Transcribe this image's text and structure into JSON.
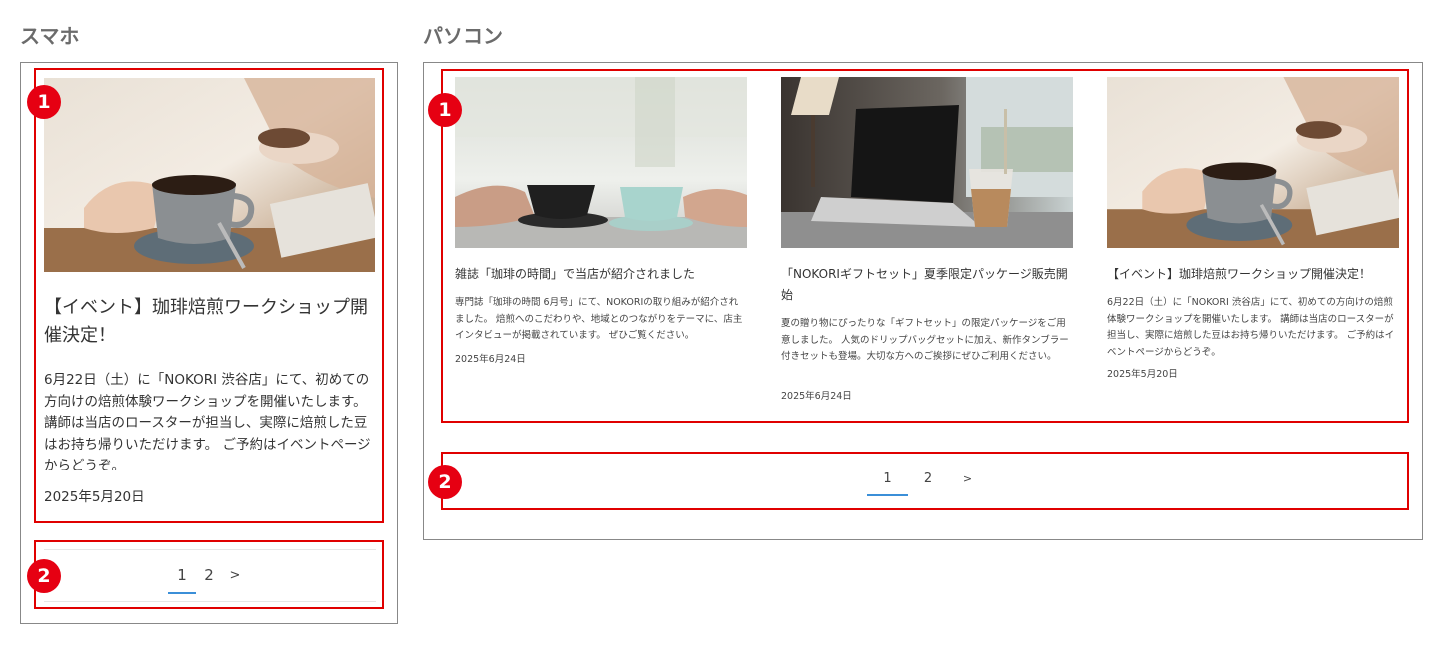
{
  "sections": {
    "mobile_title": "スマホ",
    "pc_title": "パソコン"
  },
  "badges": {
    "one": "1",
    "two": "2"
  },
  "mobile_card": {
    "title": "【イベント】珈琲焙煎ワークショップ開催決定！",
    "description": "6月22日（土）に「NOKORI 渋谷店」にて、初めての方向けの焙煎体験ワークショップを開催いたします。 講師は当店のロースターが担当し、実際に焙煎した豆はお持ち帰りいただけます。 ご予約はイベントページからどうぞ。",
    "date": "2025年5月20日",
    "image": "coffee-cup-hands-photo"
  },
  "pagination": {
    "pages": [
      "1",
      "2"
    ],
    "next": ">",
    "active": "1"
  },
  "pc_cards": [
    {
      "title": "雑誌「珈琲の時間」で当店が紹介されました",
      "description": "専門誌「珈琲の時間 6月号」にて、NOKORIの取り組みが紹介されました。 焙煎へのこだわりや、地域とのつながりをテーマに、店主インタビューが掲載されています。 ぜひご覧ください。",
      "date": "2025年6月24日",
      "image": "two-cups-toast-photo"
    },
    {
      "title": "「NOKORIギフトセット」夏季限定パッケージ販売開始",
      "description": "夏の贈り物にぴったりな「ギフトセット」の限定パッケージをご用意しました。 人気のドリップバッグセットに加え、新作タンブラー付きセットも登場。大切な方へのご挨拶にぜひご利用ください。",
      "date": "2025年6月24日",
      "image": "laptop-iced-coffee-photo"
    },
    {
      "title": "【イベント】珈琲焙煎ワークショップ開催決定！",
      "description": "6月22日（土）に「NOKORI 渋谷店」にて、初めての方向けの焙煎体験ワークショップを開催いたします。 講師は当店のロースターが担当し、実際に焙煎した豆はお持ち帰りいただけます。 ご予約はイベントページからどうぞ。",
      "date": "2025年5月20日",
      "image": "coffee-cup-hands-photo"
    }
  ],
  "colors": {
    "highlight": "#e00000",
    "badge": "#e60012",
    "active_page": "#3b8fd8"
  }
}
